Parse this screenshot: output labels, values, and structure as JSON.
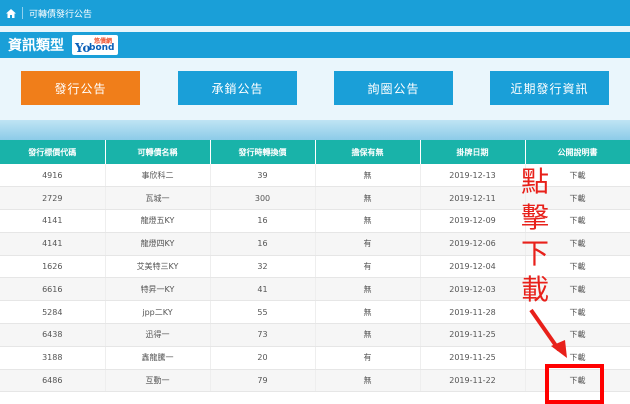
{
  "topbar": {
    "breadcrumb": "可轉債發行公告"
  },
  "header": {
    "title": "資訊類型",
    "logo_top": "悠債網",
    "logo_yo": "Yo",
    "logo_bond": "bond"
  },
  "nav_buttons": [
    {
      "label": "發行公告",
      "color": "#f07e1a"
    },
    {
      "label": "承銷公告",
      "color": "#1a9fd8"
    },
    {
      "label": "詢圈公告",
      "color": "#1a9fd8"
    },
    {
      "label": "近期發行資訊",
      "color": "#1a9fd8"
    }
  ],
  "table": {
    "headers": [
      "發行標價代碼",
      "可轉債名稱",
      "發行時轉換價",
      "擔保有無",
      "掛牌日期",
      "公開說明書"
    ],
    "rows": [
      [
        "4916",
        "事欣科二",
        "39",
        "無",
        "2019-12-13",
        "下載"
      ],
      [
        "2729",
        "瓦城一",
        "300",
        "無",
        "2019-12-11",
        "下載"
      ],
      [
        "4141",
        "龍燈五KY",
        "16",
        "無",
        "2019-12-09",
        "下載"
      ],
      [
        "4141",
        "龍燈四KY",
        "16",
        "有",
        "2019-12-06",
        "下載"
      ],
      [
        "1626",
        "艾美特三KY",
        "32",
        "有",
        "2019-12-04",
        "下載"
      ],
      [
        "6616",
        "特昇一KY",
        "41",
        "無",
        "2019-12-03",
        "下載"
      ],
      [
        "5284",
        "jpp二KY",
        "55",
        "無",
        "2019-11-28",
        "下載"
      ],
      [
        "6438",
        "迅得一",
        "73",
        "無",
        "2019-11-25",
        "下載"
      ],
      [
        "3188",
        "鑫龍騰一",
        "20",
        "有",
        "2019-11-25",
        "下載"
      ],
      [
        "6486",
        "互動一",
        "79",
        "無",
        "2019-11-22",
        "下載"
      ]
    ]
  },
  "annotation": {
    "chars": [
      "點",
      "擊",
      "下",
      "載"
    ],
    "color": "#e8201a"
  }
}
